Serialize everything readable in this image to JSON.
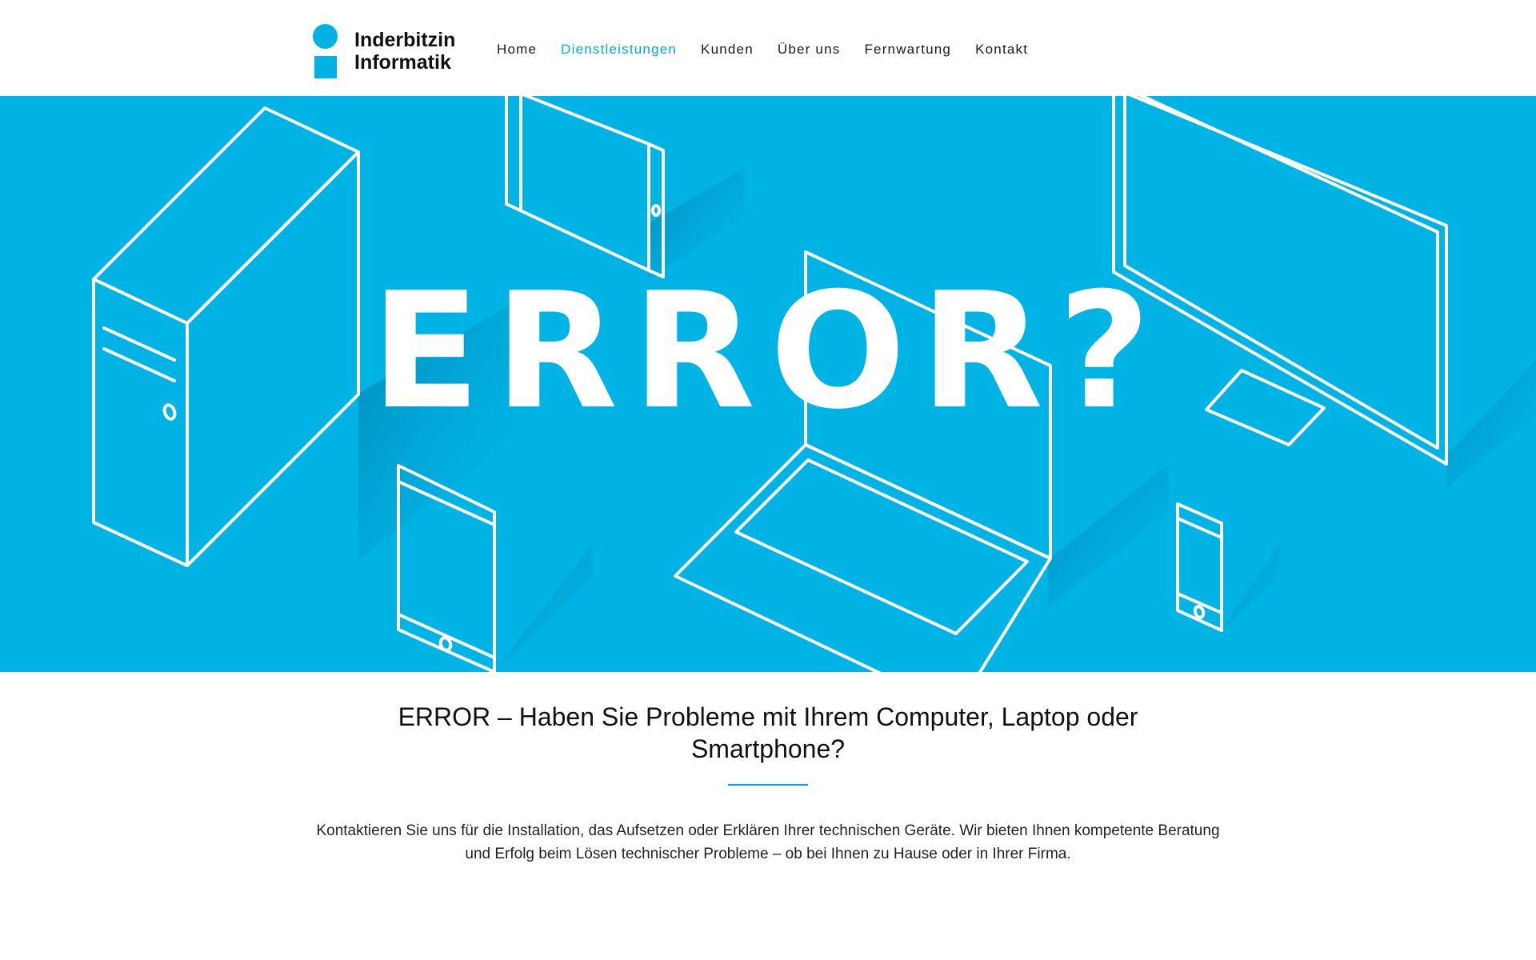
{
  "brand": {
    "line1": "Inderbitzin",
    "line2": "Informatik",
    "accent_color": "#00b2e3"
  },
  "nav": {
    "items": [
      {
        "label": "Home",
        "active": false
      },
      {
        "label": "Dienstleistungen",
        "active": true
      },
      {
        "label": "Kunden",
        "active": false
      },
      {
        "label": "Über uns",
        "active": false
      },
      {
        "label": "Fernwartung",
        "active": false
      },
      {
        "label": "Kontakt",
        "active": false
      }
    ]
  },
  "hero": {
    "title": "ERROR?",
    "background_color": "#00b3e5",
    "illustration_icons": [
      "desktop-tower-icon",
      "tablet-icon",
      "laptop-icon",
      "monitor-icon",
      "smartphone-icon"
    ]
  },
  "content": {
    "heading": "ERROR – Haben Sie Probleme mit Ihrem Computer, Laptop oder Smartphone?",
    "body": "Kontaktieren Sie uns für die Installation, das Aufsetzen oder Erklären Ihrer technischen Geräte. Wir bieten Ihnen kompetente Beratung und Erfolg beim Lösen technischer Probleme – ob bei Ihnen zu Hause oder in Ihrer Firma."
  }
}
